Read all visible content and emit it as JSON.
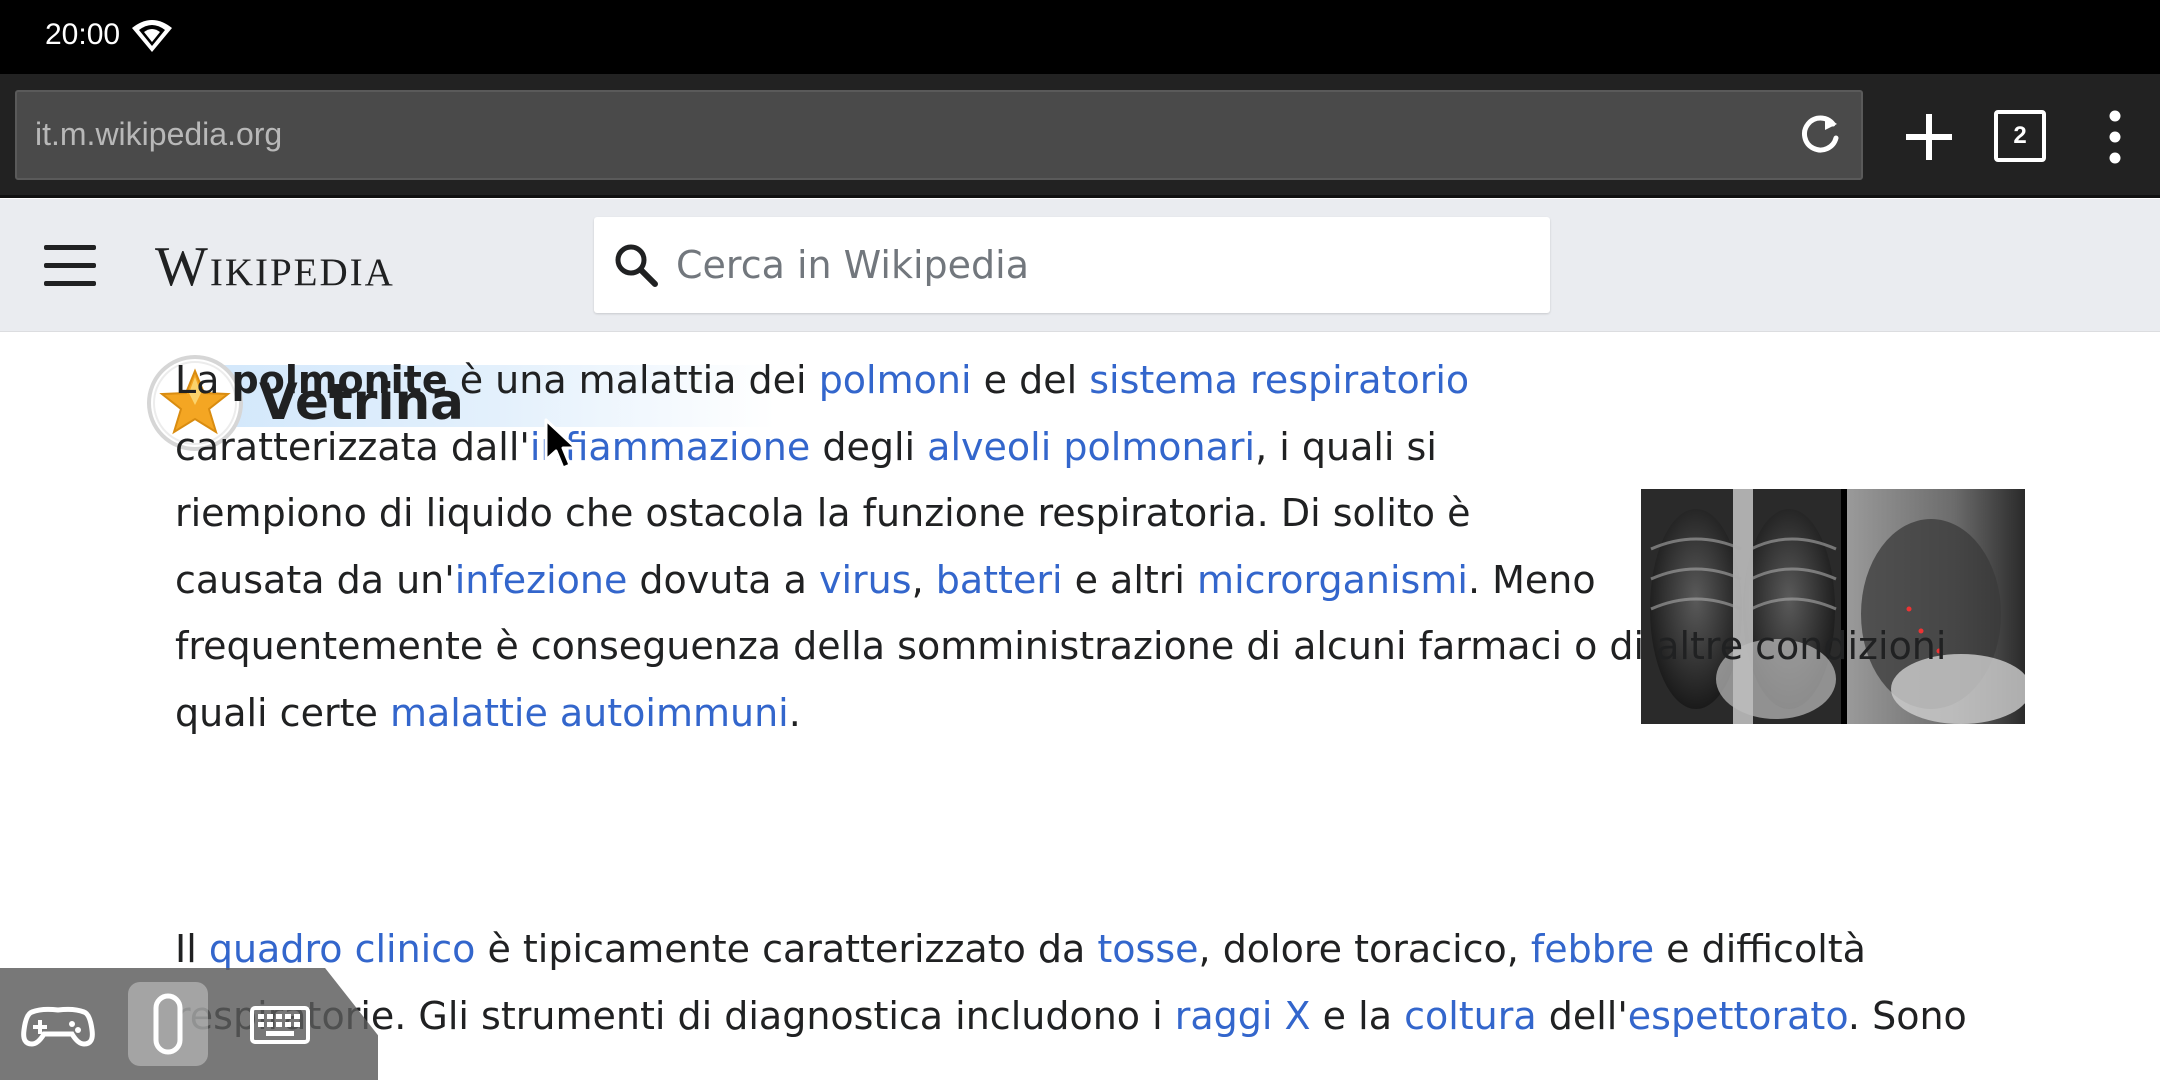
{
  "status_bar": {
    "time": "20:00"
  },
  "browser": {
    "url": "it.m.wikipedia.org",
    "tab_count": "2"
  },
  "wiki_header": {
    "wordmark": "Wikipedia",
    "search_placeholder": "Cerca in Wikipedia"
  },
  "section": {
    "title": "Vetrina"
  },
  "paragraph1": {
    "l1": {
      "t1": "La ",
      "b1": "polmonite",
      "t2": " è una malattia dei ",
      "a1": "polmoni",
      "t3": " e del ",
      "a2": "sistema respiratorio"
    },
    "l2": {
      "t1": "caratterizzata dall'",
      "a1": "infiammazione",
      "t2": " degli ",
      "a2": "alveoli polmonari",
      "t3": ", i quali si"
    },
    "l3": {
      "t1": "riempiono di liquido che ostacola la funzione respiratoria. Di solito è"
    },
    "l4": {
      "t1": "causata da un'",
      "a1": "infezione",
      "t2": " dovuta a ",
      "a2": "virus",
      "t3": ", ",
      "a3": "batteri",
      "t4": " e altri ",
      "a4": "microrganismi",
      "t5": ". Meno"
    },
    "l5": {
      "t1": "frequentemente è conseguenza della somministrazione di alcuni farmaci o di altre condizioni"
    },
    "l6": {
      "t1": "quali certe ",
      "a1": "malattie autoimmuni",
      "t2": "."
    }
  },
  "paragraph2": {
    "l1": {
      "t1": "Il ",
      "a1": "quadro clinico",
      "t2": " è tipicamente caratterizzato da ",
      "a2": "tosse",
      "t3": ", dolore toracico, ",
      "a3": "febbre",
      "t4": " e difficoltà"
    },
    "l2": {
      "t1": "respiratorie. Gli strumenti di diagnostica includono i ",
      "a1": "raggi X",
      "t2": " e la ",
      "a2": "coltura",
      "t3": " dell'",
      "a3": "espettorato",
      "t4": ". Sono"
    }
  },
  "colors": {
    "link": "#3366cc",
    "text": "#202122",
    "header_bg": "#eaecf0",
    "toolbar_bg": "#222222"
  },
  "icons": [
    "wifi-icon",
    "reload-icon",
    "plus-icon",
    "more-vert-icon",
    "hamburger-icon",
    "search-icon",
    "featured-star-icon",
    "mouse-cursor",
    "gamepad-icon",
    "mouse-icon",
    "keyboard-icon"
  ]
}
